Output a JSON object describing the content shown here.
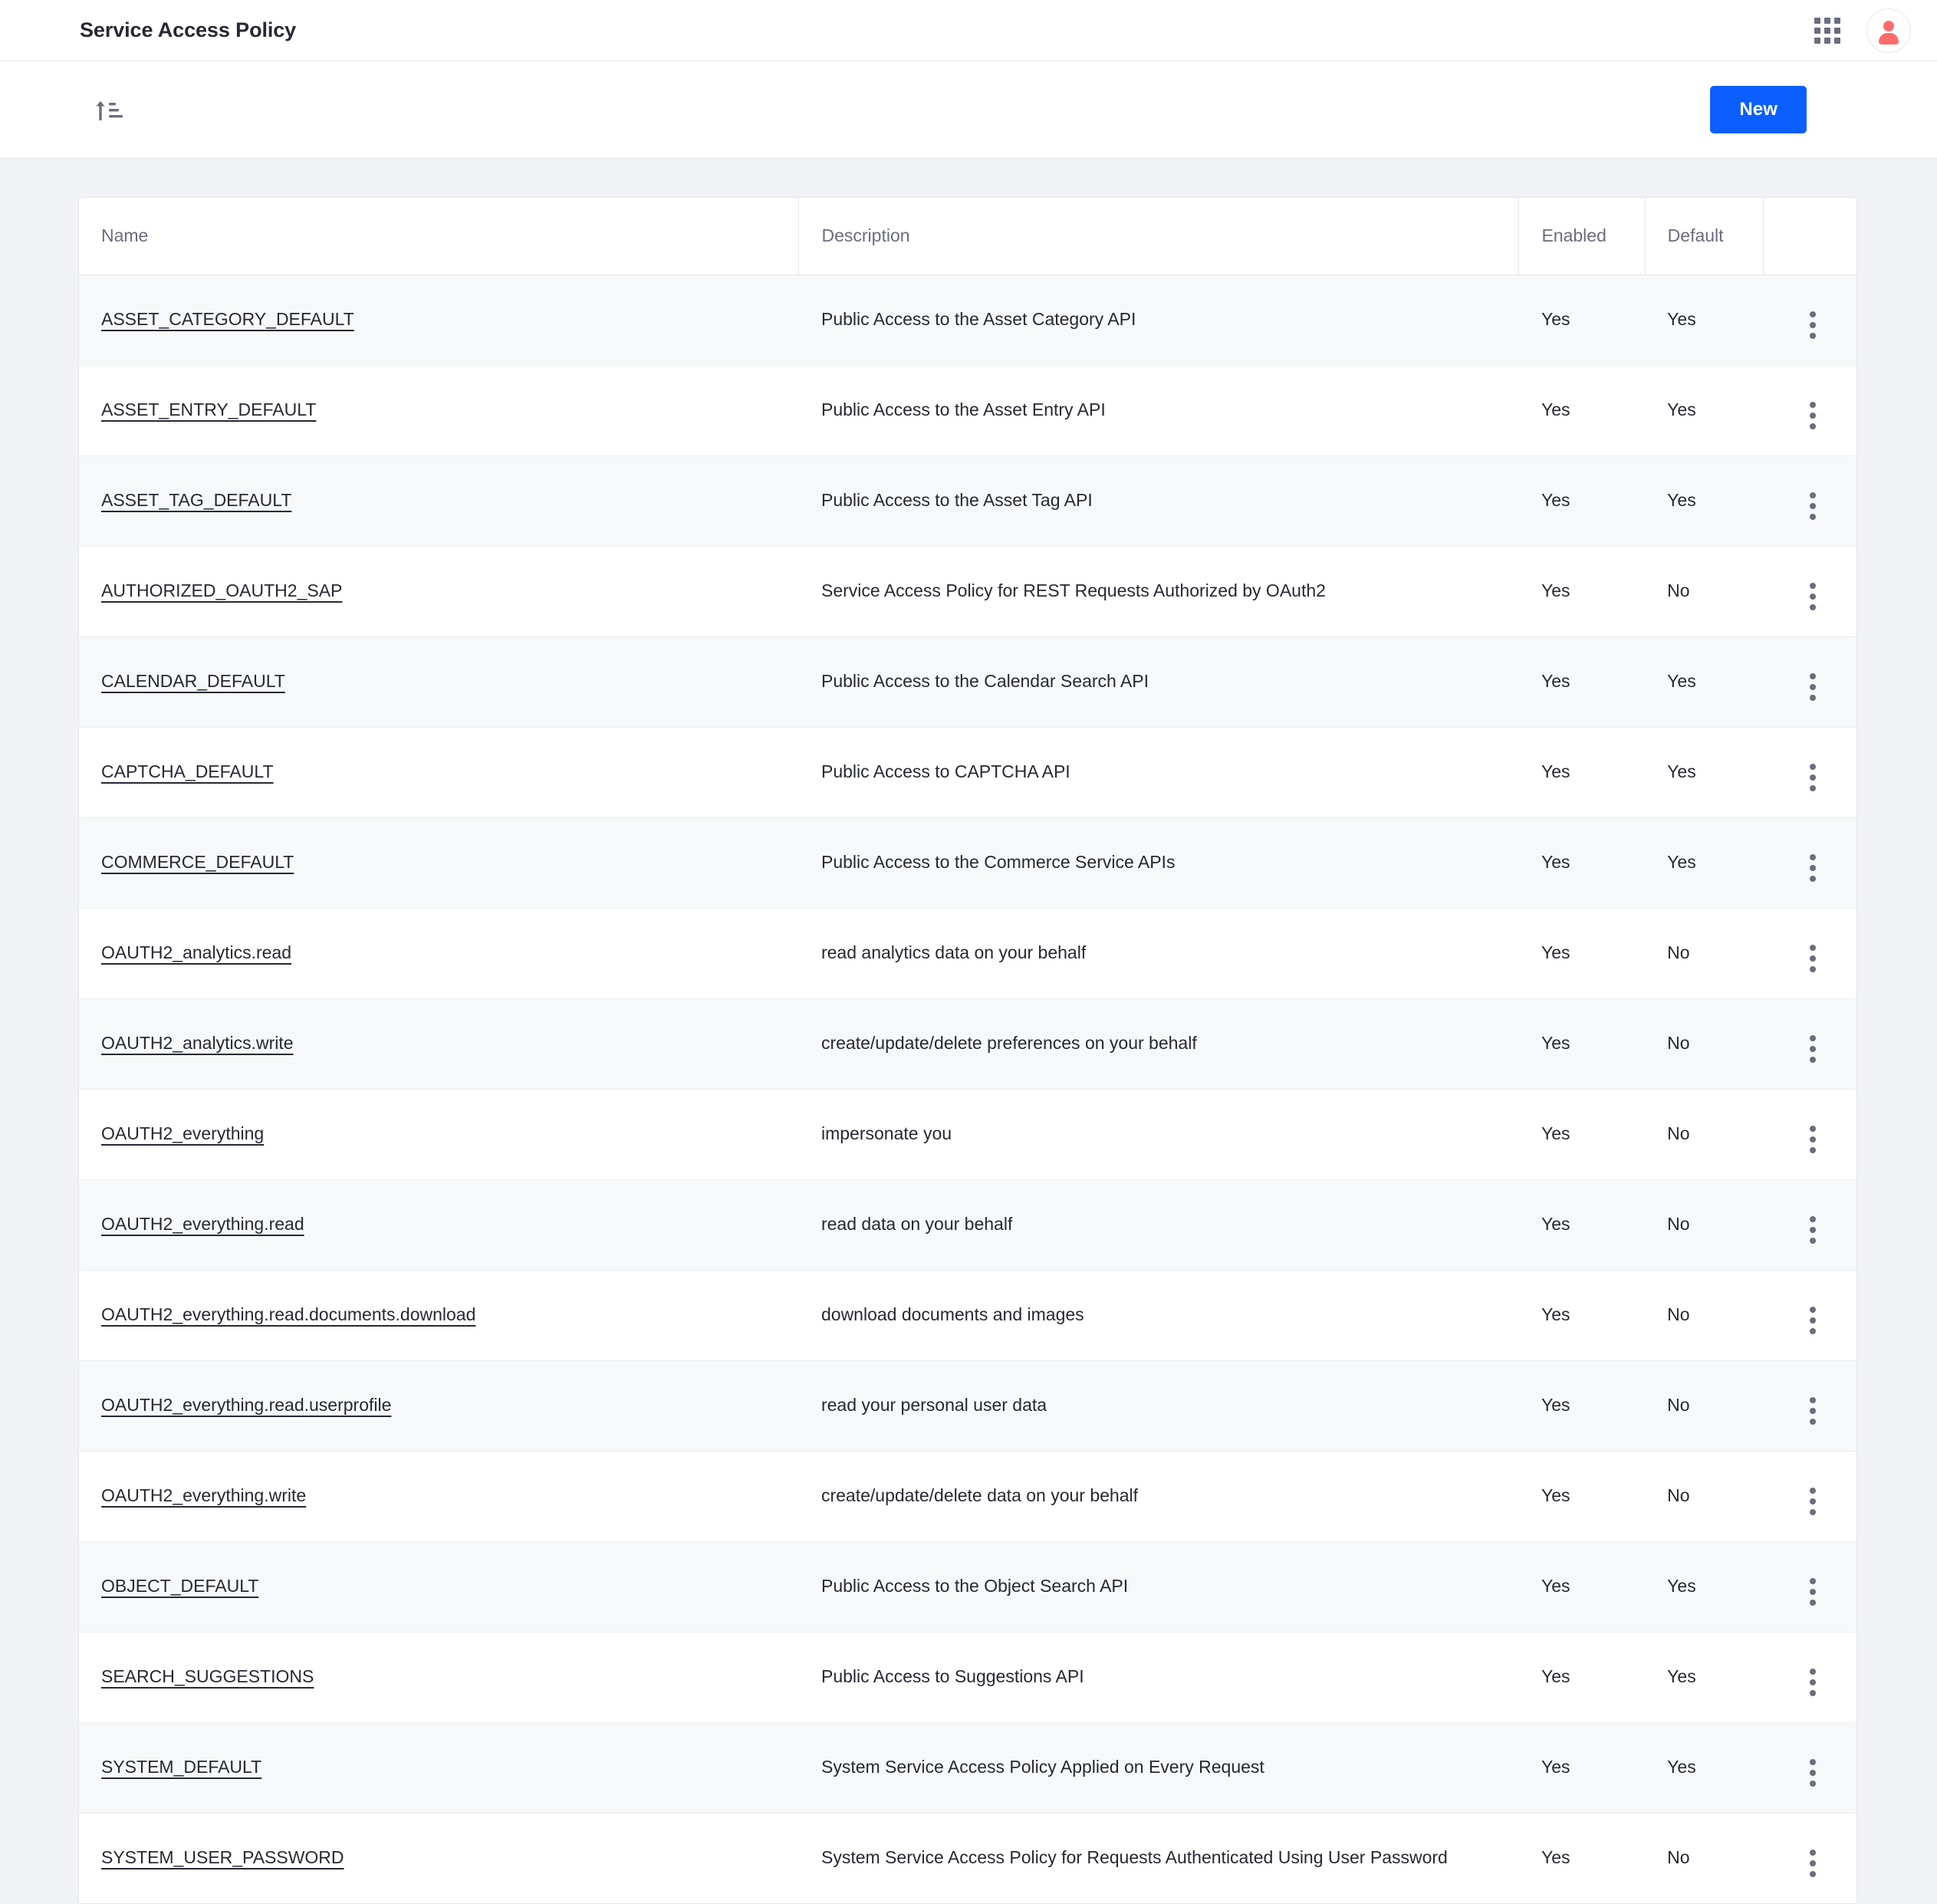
{
  "header": {
    "title": "Service Access Policy",
    "grid_icon": "app-grid-icon",
    "avatar_icon": "user-avatar-icon"
  },
  "toolbar": {
    "sort_icon": "sort-ascending-icon",
    "new_label": "New"
  },
  "table": {
    "columns": [
      "Name",
      "Description",
      "Enabled",
      "Default",
      ""
    ],
    "rows": [
      {
        "name": "ASSET_CATEGORY_DEFAULT",
        "description": "Public Access to the Asset Category API",
        "enabled": "Yes",
        "default": "Yes"
      },
      {
        "name": "ASSET_ENTRY_DEFAULT",
        "description": "Public Access to the Asset Entry API",
        "enabled": "Yes",
        "default": "Yes"
      },
      {
        "name": "ASSET_TAG_DEFAULT",
        "description": "Public Access to the Asset Tag API",
        "enabled": "Yes",
        "default": "Yes"
      },
      {
        "name": "AUTHORIZED_OAUTH2_SAP",
        "description": "Service Access Policy for REST Requests Authorized by OAuth2",
        "enabled": "Yes",
        "default": "No"
      },
      {
        "name": "CALENDAR_DEFAULT",
        "description": "Public Access to the Calendar Search API",
        "enabled": "Yes",
        "default": "Yes"
      },
      {
        "name": "CAPTCHA_DEFAULT",
        "description": "Public Access to CAPTCHA API",
        "enabled": "Yes",
        "default": "Yes"
      },
      {
        "name": "COMMERCE_DEFAULT",
        "description": "Public Access to the Commerce Service APIs",
        "enabled": "Yes",
        "default": "Yes"
      },
      {
        "name": "OAUTH2_analytics.read",
        "description": "read analytics data on your behalf",
        "enabled": "Yes",
        "default": "No"
      },
      {
        "name": "OAUTH2_analytics.write",
        "description": "create/update/delete preferences on your behalf",
        "enabled": "Yes",
        "default": "No"
      },
      {
        "name": "OAUTH2_everything",
        "description": "impersonate you",
        "enabled": "Yes",
        "default": "No"
      },
      {
        "name": "OAUTH2_everything.read",
        "description": "read data on your behalf",
        "enabled": "Yes",
        "default": "No"
      },
      {
        "name": "OAUTH2_everything.read.documents.download",
        "description": "download documents and images",
        "enabled": "Yes",
        "default": "No"
      },
      {
        "name": "OAUTH2_everything.read.userprofile",
        "description": "read your personal user data",
        "enabled": "Yes",
        "default": "No"
      },
      {
        "name": "OAUTH2_everything.write",
        "description": "create/update/delete data on your behalf",
        "enabled": "Yes",
        "default": "No"
      },
      {
        "name": "OBJECT_DEFAULT",
        "description": "Public Access to the Object Search API",
        "enabled": "Yes",
        "default": "Yes"
      },
      {
        "name": "SEARCH_SUGGESTIONS",
        "description": "Public Access to Suggestions API",
        "enabled": "Yes",
        "default": "Yes"
      },
      {
        "name": "SYSTEM_DEFAULT",
        "description": "System Service Access Policy Applied on Every Request",
        "enabled": "Yes",
        "default": "Yes"
      },
      {
        "name": "SYSTEM_USER_PASSWORD",
        "description": "System Service Access Policy for Requests Authenticated Using User Password",
        "enabled": "Yes",
        "default": "No"
      }
    ],
    "row_menu_icon": "kebab-menu-icon"
  },
  "colors": {
    "accent": "#0B5FFF",
    "avatar": "#FF6B6B",
    "text": "#272833",
    "muted": "#6B6C7E",
    "page_bg": "#F1F2F5",
    "row_alt_bg": "#F7F8F9"
  }
}
